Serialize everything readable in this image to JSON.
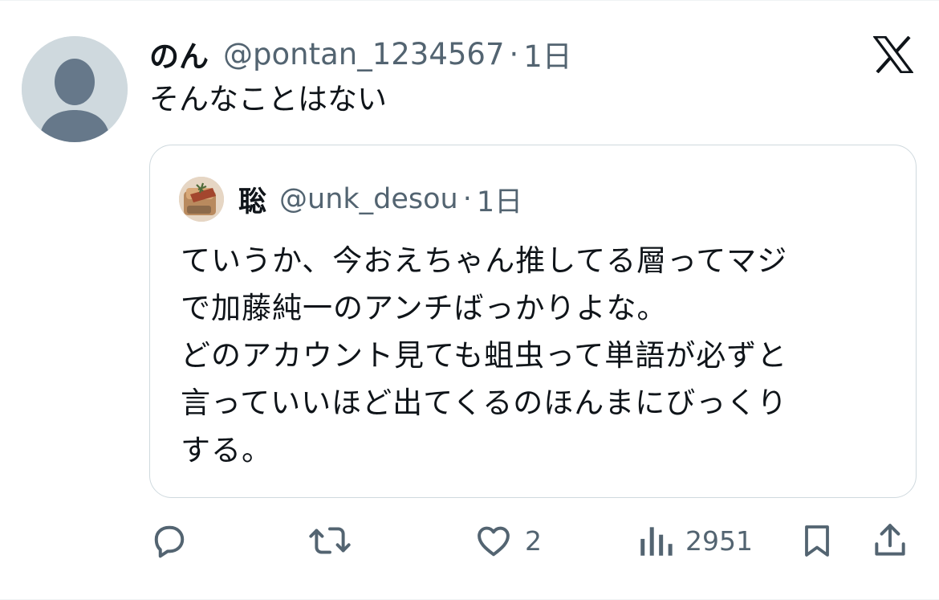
{
  "tweet": {
    "display_name": "のん",
    "handle": "@pontan_1234567",
    "separator": "·",
    "time": "1日",
    "text": "そんなことはない"
  },
  "quote": {
    "display_name": "聡",
    "handle": "@unk_desou",
    "separator": "·",
    "time": "1日",
    "lines": [
      "ていうか、今おえちゃん推してる層ってマジ",
      "で加藤純一のアンチばっかりよな。",
      "どのアカウント見ても蛆虫って単語が必ずと",
      "言っていいほど出てくるのほんまにびっくり",
      "する。"
    ]
  },
  "actions": {
    "reply_icon": "reply-icon",
    "retweet_icon": "retweet-icon",
    "like_icon": "heart-icon",
    "like_count": "2",
    "views_icon": "views-icon",
    "views_count": "2951",
    "bookmark_icon": "bookmark-icon",
    "share_icon": "share-icon"
  },
  "colors": {
    "text_primary": "#0f1419",
    "text_secondary": "#536471",
    "border": "#cfd9de",
    "avatar_placeholder": "#cfd9de"
  }
}
